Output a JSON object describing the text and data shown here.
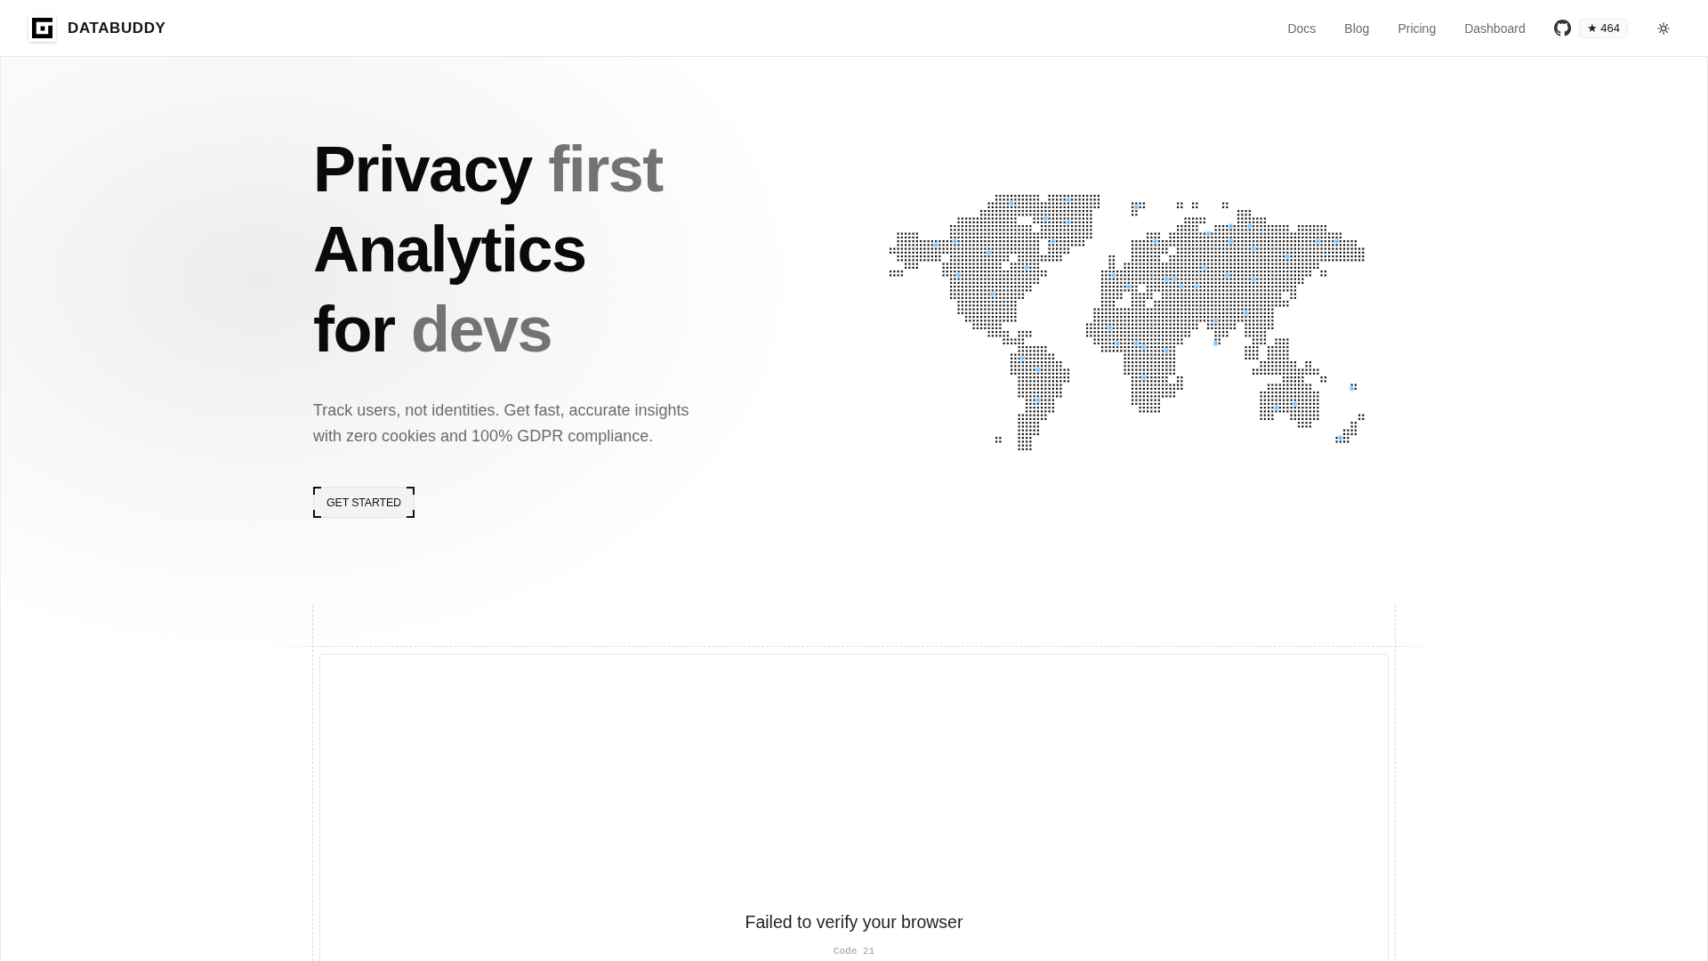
{
  "header": {
    "logo_text": "DATABUDDY",
    "nav_links": [
      "Docs",
      "Blog",
      "Pricing",
      "Dashboard"
    ],
    "github_stars": "★ 464"
  },
  "hero": {
    "headline_lines": [
      [
        {
          "text": "Privacy",
          "muted": false
        },
        {
          "text": "first",
          "muted": true
        }
      ],
      [
        {
          "text": "Analytics",
          "muted": false
        }
      ],
      [
        {
          "text": "for",
          "muted": false
        },
        {
          "text": "devs",
          "muted": true
        }
      ]
    ],
    "subtitle": "Track users, not identities. Get fast, accurate insights with zero cookies and 100% GDPR compliance.",
    "cta_label": "GET STARTED"
  },
  "preview": {
    "message": "Failed to verify your browser",
    "code": "Code 21"
  }
}
